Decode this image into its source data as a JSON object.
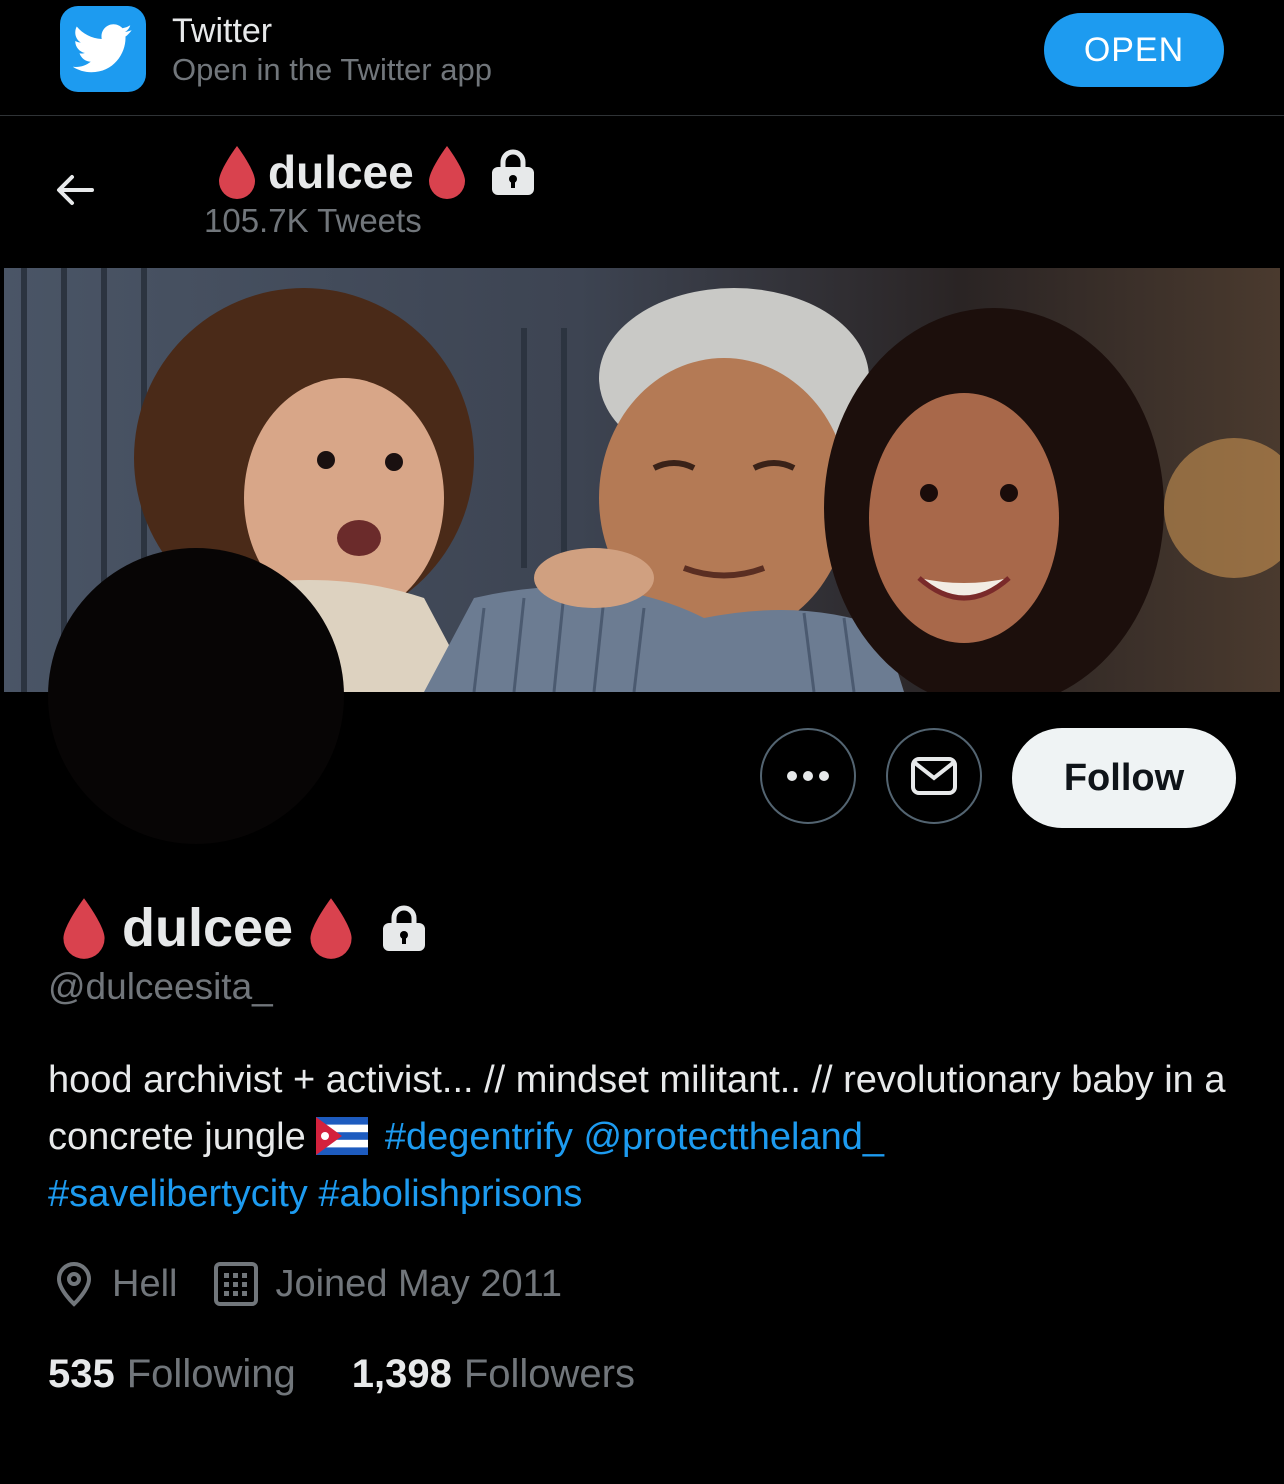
{
  "app_banner": {
    "app_name": "Twitter",
    "subtitle": "Open in the Twitter app",
    "open_label": "OPEN"
  },
  "header": {
    "name": "dulcee",
    "tweet_count": "105.7K Tweets"
  },
  "actions": {
    "follow_label": "Follow"
  },
  "profile": {
    "name": "dulcee",
    "handle": "@dulceesita_",
    "bio": {
      "text1": "hood archivist + activist... // mindset militant.. // revolutionary baby in a concrete jungle ",
      "hashtag1": "#degentrify",
      "mention": "@protecttheland_",
      "hashtag2": "#savelibertycity",
      "hashtag3": "#abolishprisons"
    },
    "location": "Hell",
    "joined": "Joined May 2011",
    "following_count": "535",
    "following_label": "Following",
    "followers_count": "1,398",
    "followers_label": "Followers"
  },
  "colors": {
    "accent": "#1d9bf0",
    "drop": "#d9424e",
    "background": "#000000"
  },
  "icons": [
    "twitter-bird-icon",
    "back-arrow-icon",
    "blood-drop-icon",
    "lock-icon",
    "more-icon",
    "mail-icon",
    "location-icon",
    "calendar-icon",
    "cuba-flag-icon"
  ]
}
